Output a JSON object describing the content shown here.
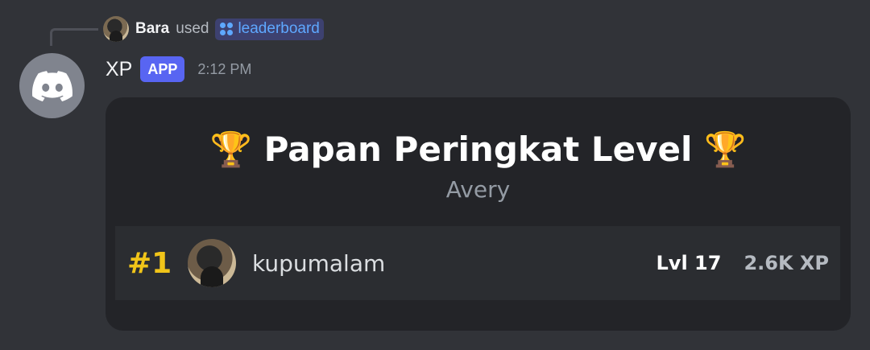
{
  "interaction": {
    "user": "Bara",
    "used_text": "used",
    "command": "leaderboard"
  },
  "message": {
    "bot_name": "XP",
    "badge": "APP",
    "timestamp": "2:12 PM"
  },
  "embed": {
    "title": "🏆 Papan Peringkat Level 🏆",
    "subtitle": "Avery",
    "rows": [
      {
        "rank": "#1",
        "name": "kupumalam",
        "level": "Lvl 17",
        "xp": "2.6K XP"
      }
    ]
  },
  "colors": {
    "background": "#313338",
    "embed_bg": "#232428",
    "row_bg": "#2b2d31",
    "app_badge": "#5865f2",
    "rank_gold": "#f0c419",
    "command_link": "#5ea8ff",
    "bot_avatar_bg": "#80848e"
  },
  "icons": {
    "command": "slash-command-icon",
    "bot_avatar": "discord-logo-icon"
  }
}
